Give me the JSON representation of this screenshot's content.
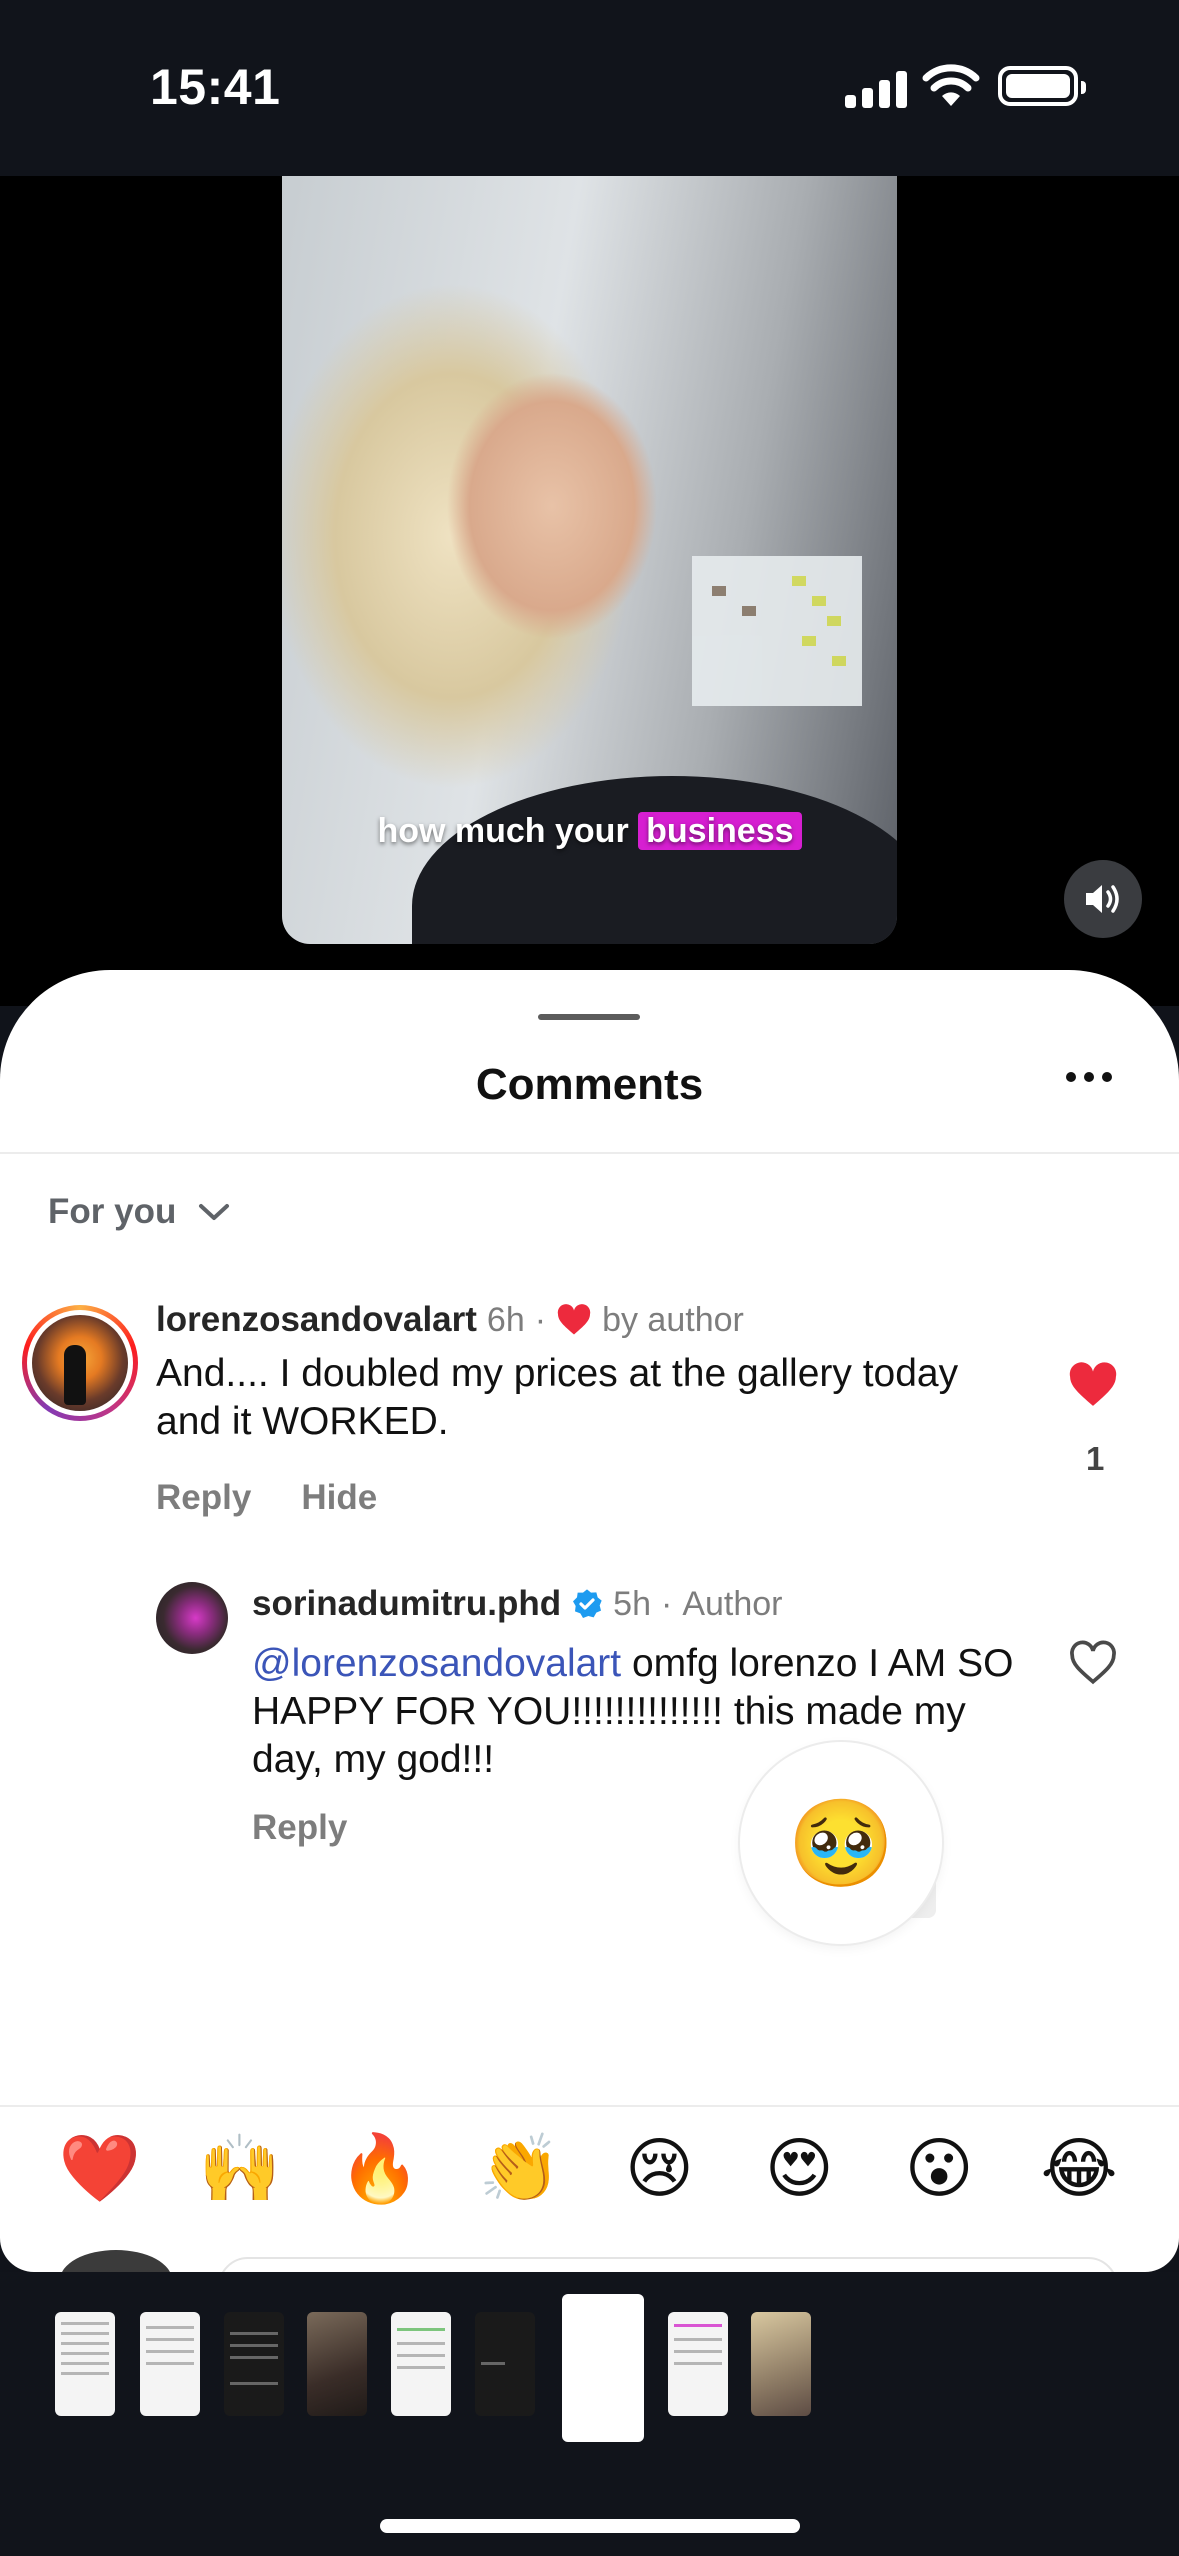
{
  "status_bar": {
    "time": "15:41"
  },
  "video": {
    "caption_prefix": "how much your",
    "caption_highlight": "business",
    "highlight_color": "#d61fd1",
    "sound_icon": "speaker-icon"
  },
  "comments_sheet": {
    "title": "Comments",
    "more_icon": "more-dots-icon",
    "sort": {
      "label": "For you",
      "icon": "chevron-down-icon"
    }
  },
  "comments": [
    {
      "username": "lorenzosandovalart",
      "time": "6h",
      "separator": "·",
      "liked_by": "by author",
      "text": "And.... I doubled my prices at the gallery today and it WORKED.",
      "actions": [
        "Reply",
        "Hide"
      ],
      "likes": "1",
      "liked": true
    },
    {
      "username": "sorinadumitru.phd",
      "verified": true,
      "time": "5h",
      "separator": "·",
      "role": "Author",
      "mention": "@lorenzosandovalart",
      "text": " omfg lorenzo I AM SO HAPPY FOR YOU!!!!!!!!!!!!!! this made my day, my god!!!",
      "actions": [
        "Reply"
      ],
      "liked": false,
      "reaction_popup": "🥹"
    }
  ],
  "quick_reactions": [
    "❤️",
    "🙌",
    "🔥",
    "👏",
    "😢",
    "😍",
    "😮",
    "😂"
  ],
  "colors": {
    "like_red": "#ed2a3d",
    "mention_blue": "#3b55b8",
    "verified_blue": "#1d9bf0"
  }
}
